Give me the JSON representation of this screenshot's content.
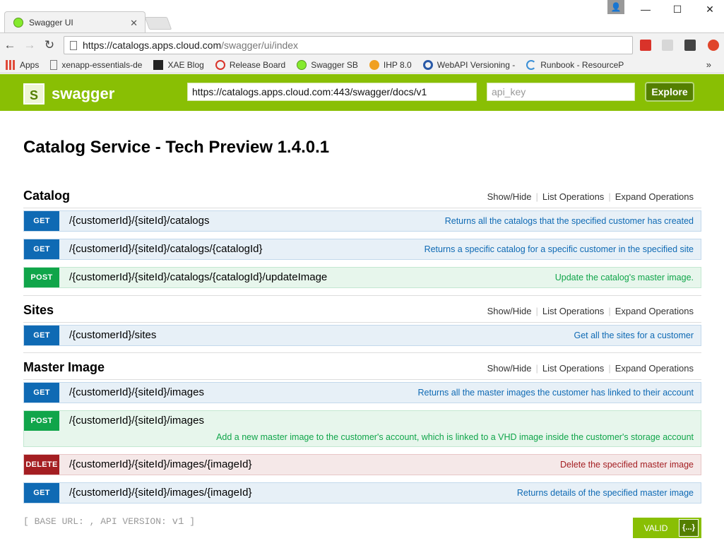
{
  "browser": {
    "tab_title": "Swagger UI",
    "url_host": "https://catalogs.apps.cloud.com",
    "url_path": "/swagger/ui/index",
    "bookmarks": [
      {
        "label": "Apps",
        "icon": "apps-grid-icon",
        "color": "#e04a3a"
      },
      {
        "label": "xenapp-essentials-de",
        "icon": "page-icon",
        "color": "#777777"
      },
      {
        "label": "XAE Blog",
        "icon": "xae-blog-icon",
        "color": "#222222"
      },
      {
        "label": "Release Board",
        "icon": "release-board-icon",
        "color": "#d9332a"
      },
      {
        "label": "Swagger SB",
        "icon": "swagger-icon",
        "color": "#85ea2d"
      },
      {
        "label": "IHP 8.0",
        "icon": "ihp-icon",
        "color": "#f0a020"
      },
      {
        "label": "WebAPI Versioning -",
        "icon": "webapi-icon",
        "color": "#2a5aa8"
      },
      {
        "label": "Runbook - ResourceP",
        "icon": "runbook-icon",
        "color": "#3a8fd6"
      }
    ]
  },
  "header": {
    "logo_text": "swagger",
    "logo_letter": "S",
    "docs_url": "https://catalogs.apps.cloud.com:443/swagger/docs/v1",
    "api_key_placeholder": "api_key",
    "explore_label": "Explore"
  },
  "page_title": "Catalog Service - Tech Preview 1.4.0.1",
  "resource_links": {
    "show_hide": "Show/Hide",
    "list_ops": "List Operations",
    "expand_ops": "Expand Operations"
  },
  "resources": [
    {
      "name": "Catalog",
      "operations": [
        {
          "method": "GET",
          "path": "/{customerId}/{siteId}/catalogs",
          "summary": "Returns all the catalogs that the specified customer has created"
        },
        {
          "method": "GET",
          "path": "/{customerId}/{siteId}/catalogs/{catalogId}",
          "summary": "Returns a specific catalog for a specific customer in the specified site"
        },
        {
          "method": "POST",
          "path": "/{customerId}/{siteId}/catalogs/{catalogId}/updateImage",
          "summary": "Update the catalog's master image."
        }
      ]
    },
    {
      "name": "Sites",
      "operations": [
        {
          "method": "GET",
          "path": "/{customerId}/sites",
          "summary": "Get all the sites for a customer"
        }
      ]
    },
    {
      "name": "Master Image",
      "operations": [
        {
          "method": "GET",
          "path": "/{customerId}/{siteId}/images",
          "summary": "Returns all the master images the customer has linked to their account"
        },
        {
          "method": "POST",
          "path": "/{customerId}/{siteId}/images",
          "summary": "Add a new master image to the customer's account, which is linked to a VHD image inside the customer's storage account"
        },
        {
          "method": "DELETE",
          "path": "/{customerId}/{siteId}/images/{imageId}",
          "summary": "Delete the specified master image"
        },
        {
          "method": "GET",
          "path": "/{customerId}/{siteId}/images/{imageId}",
          "summary": "Returns details of the specified master image"
        }
      ]
    }
  ],
  "footer": {
    "base_url_text": "[ BASE URL: , API VERSION: ",
    "api_version": "v1",
    "close_bracket": " ]",
    "valid_label": "VALID",
    "valid_icon": "{...}"
  },
  "colors": {
    "swagger_green": "#89bf04",
    "get": "#0f6ab4",
    "post": "#10a54a",
    "delete": "#a41e22"
  }
}
